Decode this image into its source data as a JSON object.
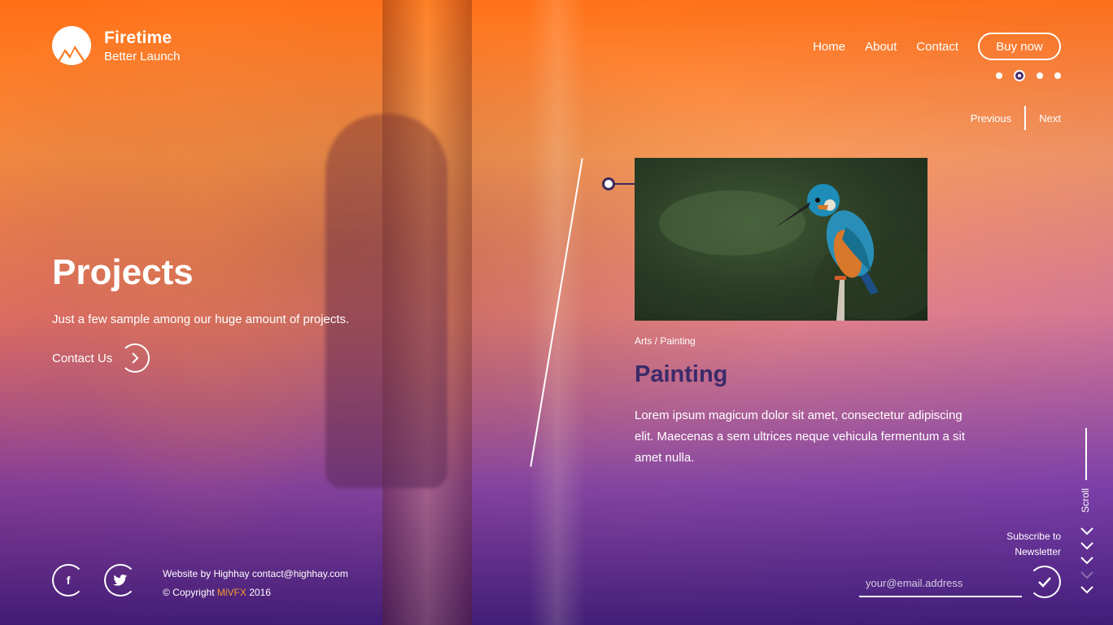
{
  "brand": {
    "name": "Firetime",
    "tagline": "Better Launch",
    "logo_icon": "mountain-sun-icon"
  },
  "nav": {
    "items": [
      {
        "label": "Home"
      },
      {
        "label": "About"
      },
      {
        "label": "Contact"
      }
    ],
    "cta": "Buy now"
  },
  "slider": {
    "dots": 4,
    "active_index": 1
  },
  "pager": {
    "prev": "Previous",
    "next": "Next"
  },
  "hero": {
    "title": "Projects",
    "subtitle": "Just a few sample among our huge amount of projects.",
    "contact_label": "Contact Us",
    "contact_icon": "chevron-right-icon"
  },
  "project": {
    "category": "Arts / Painting",
    "title": "Painting",
    "description": "Lorem ipsum magicum dolor sit amet, consectetur adipiscing elit. Maecenas a sem ultrices neque vehicula fermentum a sit amet nulla.",
    "image_subject": "kingfisher-bird"
  },
  "scroll": {
    "label": "Scroll",
    "icon": "chevron-down-icon"
  },
  "footer": {
    "social": [
      {
        "name": "facebook",
        "glyph": "f"
      },
      {
        "name": "twitter",
        "glyph": "🐦"
      }
    ],
    "credit_prefix": "Website by Highhay contact@highhay.com",
    "copyright_prefix": "© Copyright ",
    "copyright_brand": "MiVFX",
    "copyright_year": " 2016"
  },
  "newsletter": {
    "label_line1": "Subscribe to",
    "label_line2": "Newsletter",
    "placeholder": "your@email.address",
    "submit_icon": "check-icon"
  },
  "colors": {
    "accent": "#3b2a6a",
    "brand_orange": "#f39c2e",
    "top_gradient": "#ff7a1e",
    "bottom_gradient": "#3c1978"
  }
}
